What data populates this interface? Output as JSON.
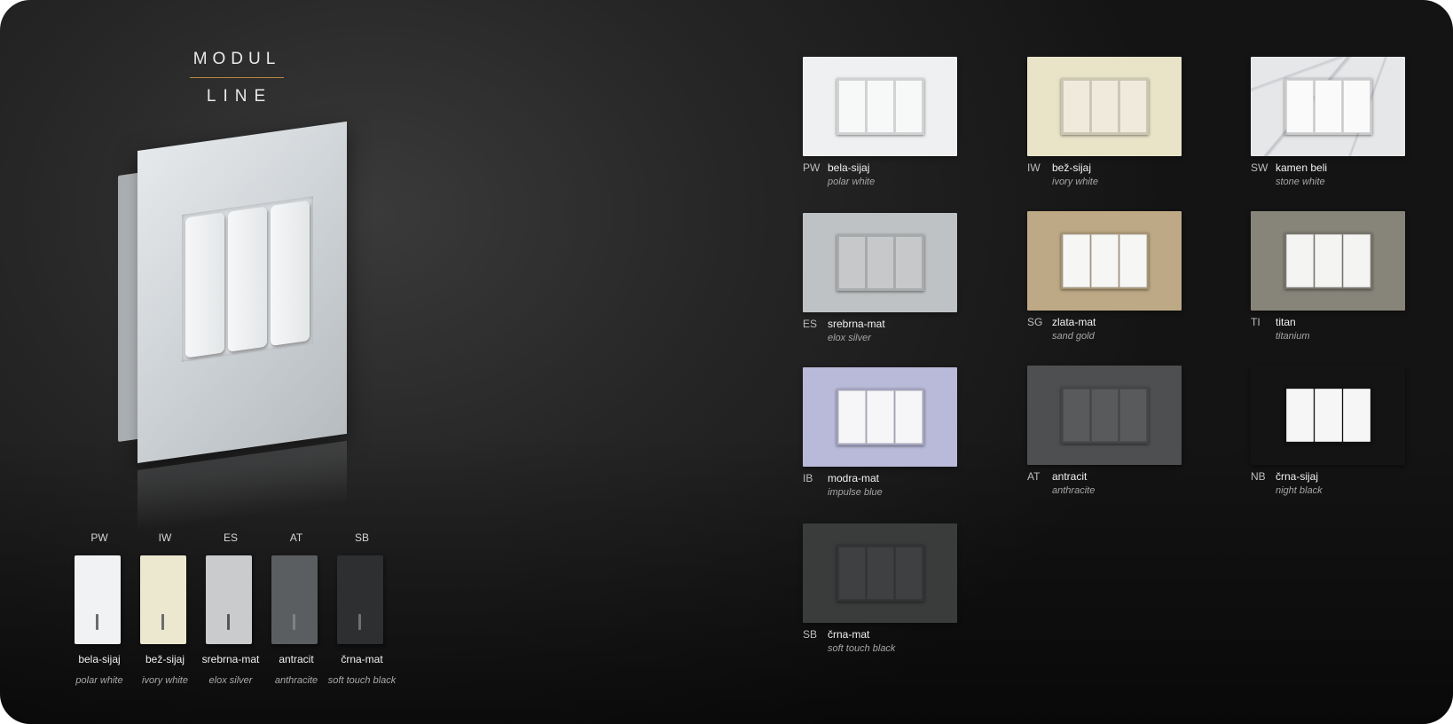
{
  "brand": {
    "logo_top": "MODUL",
    "logo_bottom": "LINE",
    "rule_color": "#b48a3c"
  },
  "modules": [
    {
      "code": "PW",
      "name": "bela-sijaj",
      "en": "polar white",
      "color": "#f1f2f3",
      "led": "#6b6b6b"
    },
    {
      "code": "IW",
      "name": "bež-sijaj",
      "en": "ivory white",
      "color": "#ece7cf",
      "led": "#6b6b6b"
    },
    {
      "code": "ES",
      "name": "srebrna-mat",
      "en": "elox silver",
      "color": "#c9cbcd",
      "led": "#555"
    },
    {
      "code": "AT",
      "name": "antracit",
      "en": "anthracite",
      "color": "#5b5e60",
      "led": "#808080"
    },
    {
      "code": "SB",
      "name": "črna-mat",
      "en": "soft touch black",
      "color": "#2d2f31",
      "led": "#707070"
    }
  ],
  "finishes": [
    {
      "code": "PW",
      "name": "bela-sijaj",
      "en": "polar white",
      "plate": "#eef0f1",
      "rocker": "#f7f8f8"
    },
    {
      "code": "IW",
      "name": "bež-sijaj",
      "en": "ivory white",
      "plate": "#e9e3c8",
      "rocker": "#efeadb"
    },
    {
      "code": "SW",
      "name": "kamen beli",
      "en": "stone white",
      "plate": "#e6e7e9",
      "rocker": "#fafafa"
    },
    {
      "code": "ES",
      "name": "srebrna-mat",
      "en": "elox silver",
      "plate": "#bfc2c4",
      "rocker": "#c6c8ca"
    },
    {
      "code": "SG",
      "name": "zlata-mat",
      "en": "sand gold",
      "plate": "#bda985",
      "rocker": "#f6f6f4"
    },
    {
      "code": "TI",
      "name": "titan",
      "en": "titanium",
      "plate": "#87857a",
      "rocker": "#f4f4f3"
    },
    {
      "code": "IB",
      "name": "modra-mat",
      "en": "impulse blue",
      "plate": "#b9bad9",
      "rocker": "#f6f6f8"
    },
    {
      "code": "AT",
      "name": "antracit",
      "en": "anthracite",
      "plate": "#4d4f50",
      "rocker": "#585a5c"
    },
    {
      "code": "NB",
      "name": "črna-sijaj",
      "en": "night black",
      "plate": "#141414",
      "rocker": "#f6f6f6"
    },
    {
      "code": "SB",
      "name": "črna-mat",
      "en": "soft touch black",
      "plate": "#3a3b3b",
      "rocker": "#3f4041"
    }
  ]
}
